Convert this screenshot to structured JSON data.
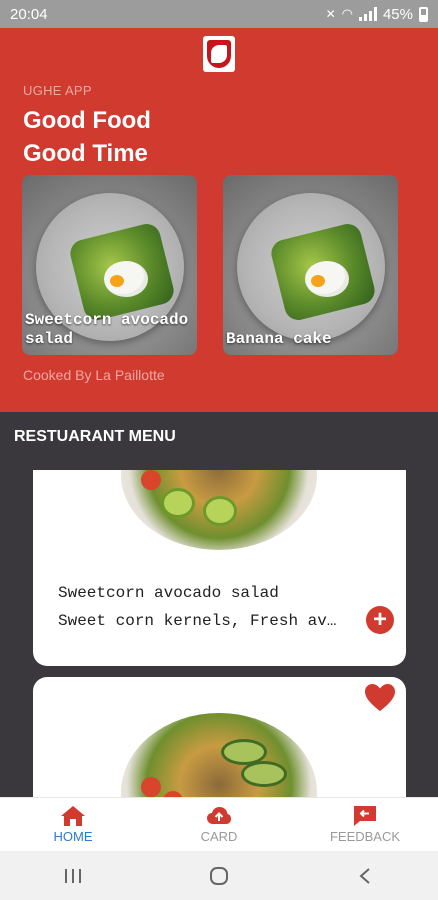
{
  "status_bar": {
    "time": "20:04",
    "battery": "45%"
  },
  "hero": {
    "app_label": "UGHE APP",
    "headline_line1": "Good Food",
    "headline_line2": "Good Time",
    "featured": [
      {
        "title": "Sweetcorn avocado salad"
      },
      {
        "title": "Banana cake"
      }
    ],
    "cooked_by": "Cooked By La Paillotte"
  },
  "menu": {
    "title": "RESTUARANT MENU",
    "items": [
      {
        "name": "Sweetcorn avocado salad",
        "description": "Sweet corn kernels, Fresh avocado, tomatoes and lime"
      },
      {
        "favorite": true
      }
    ]
  },
  "bottom_nav": {
    "items": [
      {
        "label": "HOME",
        "icon": "home-icon",
        "active": true
      },
      {
        "label": "CARD",
        "icon": "cloud-upload-icon",
        "active": false
      },
      {
        "label": "FEEDBACK",
        "icon": "feedback-icon",
        "active": false
      }
    ]
  },
  "colors": {
    "primary": "#d13a2f",
    "menu_background": "#3a383c",
    "active_nav": "#2a7bd5"
  }
}
